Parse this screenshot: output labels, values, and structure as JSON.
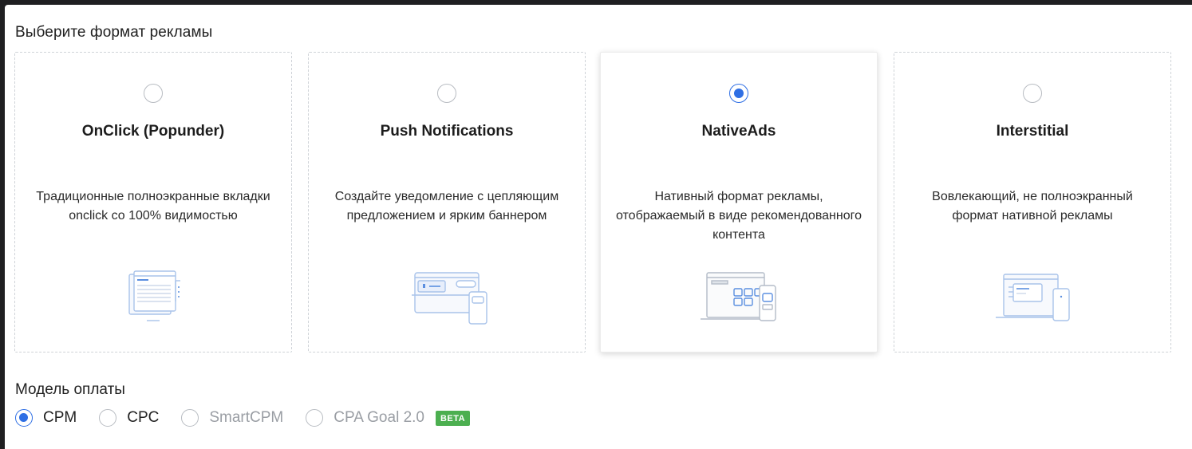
{
  "ad_format": {
    "heading": "Выберите формат рекламы",
    "cards": [
      {
        "title": "OnClick (Popunder)",
        "description": "Традиционные полноэкранные вкладки onclick со 100% видимостью",
        "selected": false,
        "icon": "popunder-illustration"
      },
      {
        "title": "Push Notifications",
        "description": "Создайте уведомление с цепляющим предложением и ярким баннером",
        "selected": false,
        "icon": "push-illustration"
      },
      {
        "title": "NativeAds",
        "description": "Нативный формат рекламы, отображаемый в виде рекомендованного контента",
        "selected": true,
        "icon": "native-illustration"
      },
      {
        "title": "Interstitial",
        "description": "Вовлекающий, не полноэкранный формат нативной рекламы",
        "selected": false,
        "icon": "interstitial-illustration"
      }
    ]
  },
  "payment_model": {
    "heading": "Модель оплаты",
    "options": [
      {
        "label": "CPM",
        "checked": true,
        "disabled": false
      },
      {
        "label": "CPC",
        "checked": false,
        "disabled": false
      },
      {
        "label": "SmartCPM",
        "checked": false,
        "disabled": true
      },
      {
        "label": "CPA Goal 2.0",
        "checked": false,
        "disabled": true,
        "badge": "BETA"
      }
    ]
  },
  "colors": {
    "accent": "#2f6fe4",
    "badge": "#4caf50",
    "illustration": "#a9c3ea"
  }
}
